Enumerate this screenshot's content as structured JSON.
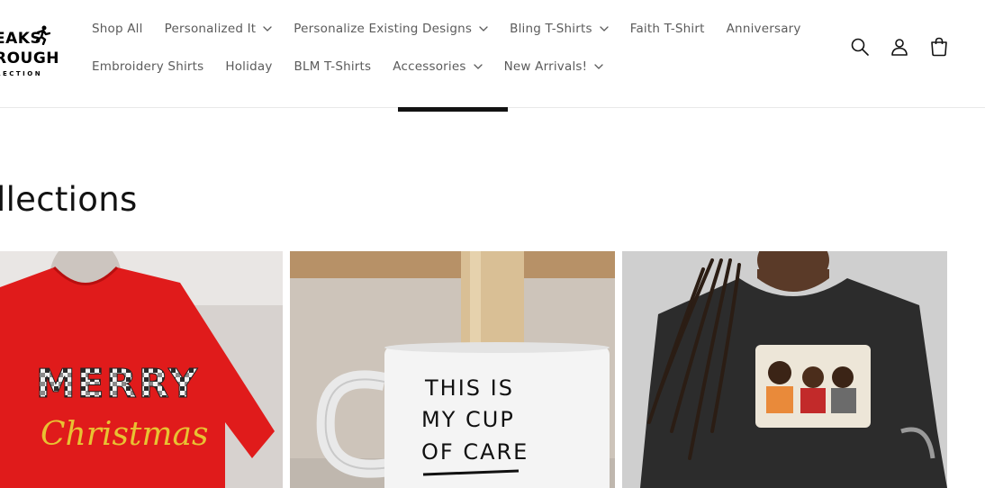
{
  "logo": {
    "line1": "EAKS",
    "line2": "ROUGH",
    "line3": "LECTION"
  },
  "nav": {
    "row1": [
      {
        "label": "Shop All",
        "dropdown": false
      },
      {
        "label": "Personalized It",
        "dropdown": true
      },
      {
        "label": "Personalize Existing Designs",
        "dropdown": true
      },
      {
        "label": "Bling T-Shirts",
        "dropdown": true
      },
      {
        "label": "Faith T-Shirt",
        "dropdown": false
      },
      {
        "label": "Anniversary",
        "dropdown": false
      }
    ],
    "row2": [
      {
        "label": "Embroidery Shirts",
        "dropdown": false
      },
      {
        "label": "Holiday",
        "dropdown": false
      },
      {
        "label": "BLM T-Shirts",
        "dropdown": false
      },
      {
        "label": "Accessories",
        "dropdown": true
      },
      {
        "label": "New Arrivals!",
        "dropdown": true
      }
    ]
  },
  "header_icons": [
    "search-icon",
    "account-icon",
    "cart-icon"
  ],
  "section": {
    "title": "llections"
  },
  "cards": [
    {
      "name": "merry-christmas-shirt",
      "text_line1": "MERRY",
      "text_line2": "Christmas"
    },
    {
      "name": "cup-of-care-mug",
      "text_line1": "THIS IS",
      "text_line2": "MY CUP",
      "text_line3": "OF CARE"
    },
    {
      "name": "graphic-tee"
    }
  ],
  "colors": {
    "text": "#121212",
    "nav_text": "#5b5b5b",
    "red_shirt": "#e01b1b",
    "gold_script": "#e8c232"
  }
}
